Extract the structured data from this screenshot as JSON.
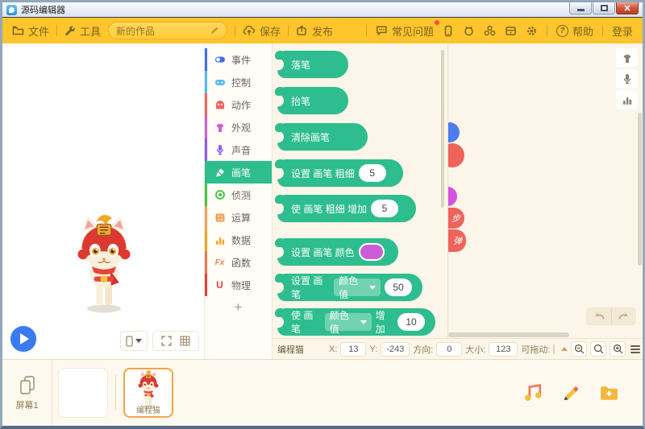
{
  "window": {
    "title": "源码编辑器"
  },
  "toolbar": {
    "file": "文件",
    "tools": "工具",
    "project_name": "新的作品",
    "save": "保存",
    "publish": "发布",
    "faq": "常见问题",
    "help": "帮助",
    "login": "登录"
  },
  "categories": [
    {
      "label": "事件"
    },
    {
      "label": "控制"
    },
    {
      "label": "动作"
    },
    {
      "label": "外观"
    },
    {
      "label": "声音"
    },
    {
      "label": "画笔",
      "selected": true
    },
    {
      "label": "侦测"
    },
    {
      "label": "运算"
    },
    {
      "label": "数据"
    },
    {
      "label": "函数"
    },
    {
      "label": "物理"
    },
    {
      "label": "+"
    }
  ],
  "blocks": [
    {
      "label": "落笔"
    },
    {
      "label": "抬笔"
    },
    {
      "label": "清除画笔"
    },
    {
      "label": "设置 画笔 粗细",
      "value": "5"
    },
    {
      "label": "使 画笔 粗细 增加",
      "value": "5"
    },
    {
      "label": "设置 画笔 颜色",
      "swatch_color": "#CB5ED8"
    },
    {
      "label": "设置 画笔",
      "dropdown": "颜色值",
      "value": "50"
    },
    {
      "label": "使 画笔",
      "dropdown": "颜色值",
      "label2": "增加",
      "value": "10"
    }
  ],
  "workspace": {
    "stub_blocks": [
      {
        "text": "步",
        "color": "#F0625C"
      },
      {
        "text": "弹",
        "color": "#F0625C"
      }
    ],
    "partial_circle_colors": [
      "#4C7CF0",
      "#F0625C",
      "#D553E0"
    ]
  },
  "status": {
    "sprite_name": "编程猫",
    "x_label": "X:",
    "x_value": "13",
    "y_label": "Y:",
    "y_value": "-243",
    "direction_label": "方向:",
    "direction_value": "0",
    "size_label": "大小:",
    "size_value": "123",
    "draggable_label": "可拖动:"
  },
  "bottom": {
    "screen_label": "屏幕1",
    "sprite_label": "编程猫"
  },
  "icons": {
    "question_glyph": "?",
    "fx_glyph": "Fx",
    "physics_glyph": "U"
  },
  "colors": {
    "toolbar_yellow": "#FEC52D",
    "block_green": "#2EBD8E",
    "pen_swatch_magenta": "#CB5ED8",
    "play_button_blue": "#3B7BF2",
    "sprite_selected_border_orange": "#F5A24B",
    "stub_red": "#F0625C",
    "stub_blue": "#4C7CF0",
    "stub_magenta": "#D553E0"
  }
}
